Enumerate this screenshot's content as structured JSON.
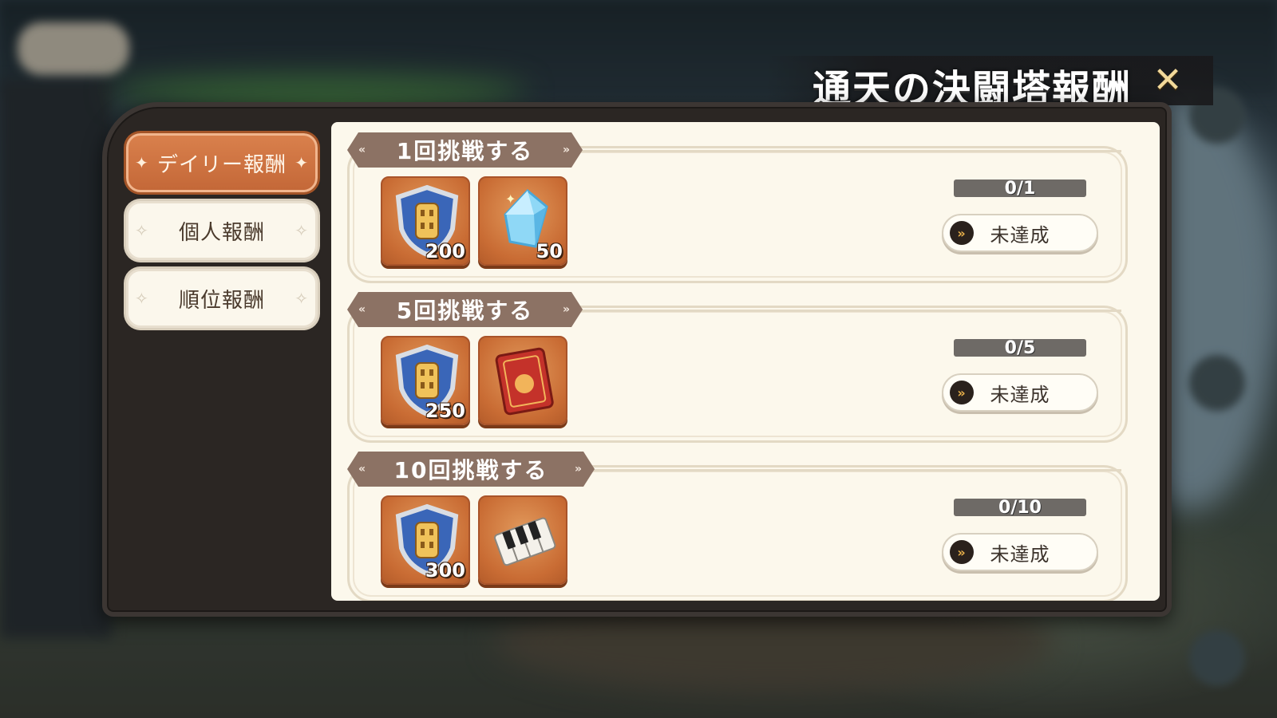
{
  "header": {
    "title": "通天の決闘塔報酬",
    "close_icon": "close-icon"
  },
  "tabs": [
    {
      "label": "デイリー報酬",
      "active": true
    },
    {
      "label": "個人報酬",
      "active": false
    },
    {
      "label": "順位報酬",
      "active": false
    }
  ],
  "rewards": [
    {
      "title": "1回挑戦する",
      "progress": "0/1",
      "status": "未達成",
      "items": [
        {
          "icon": "tower-shield-icon",
          "qty": "200"
        },
        {
          "icon": "crystal-icon",
          "qty": "50"
        }
      ]
    },
    {
      "title": "5回挑戦する",
      "progress": "0/5",
      "status": "未達成",
      "items": [
        {
          "icon": "tower-shield-icon",
          "qty": "250"
        },
        {
          "icon": "scroll-icon",
          "qty": ""
        }
      ]
    },
    {
      "title": "10回挑戦する",
      "progress": "0/10",
      "status": "未達成",
      "items": [
        {
          "icon": "tower-shield-icon",
          "qty": "300"
        },
        {
          "icon": "piano-keys-icon",
          "qty": ""
        }
      ]
    }
  ],
  "colors": {
    "tab_active": "#c96c38",
    "ribbon": "#8c7264",
    "panel": "#fcf8ec",
    "item_bg": "#c96c34",
    "progress_track": "#6e6a66"
  }
}
